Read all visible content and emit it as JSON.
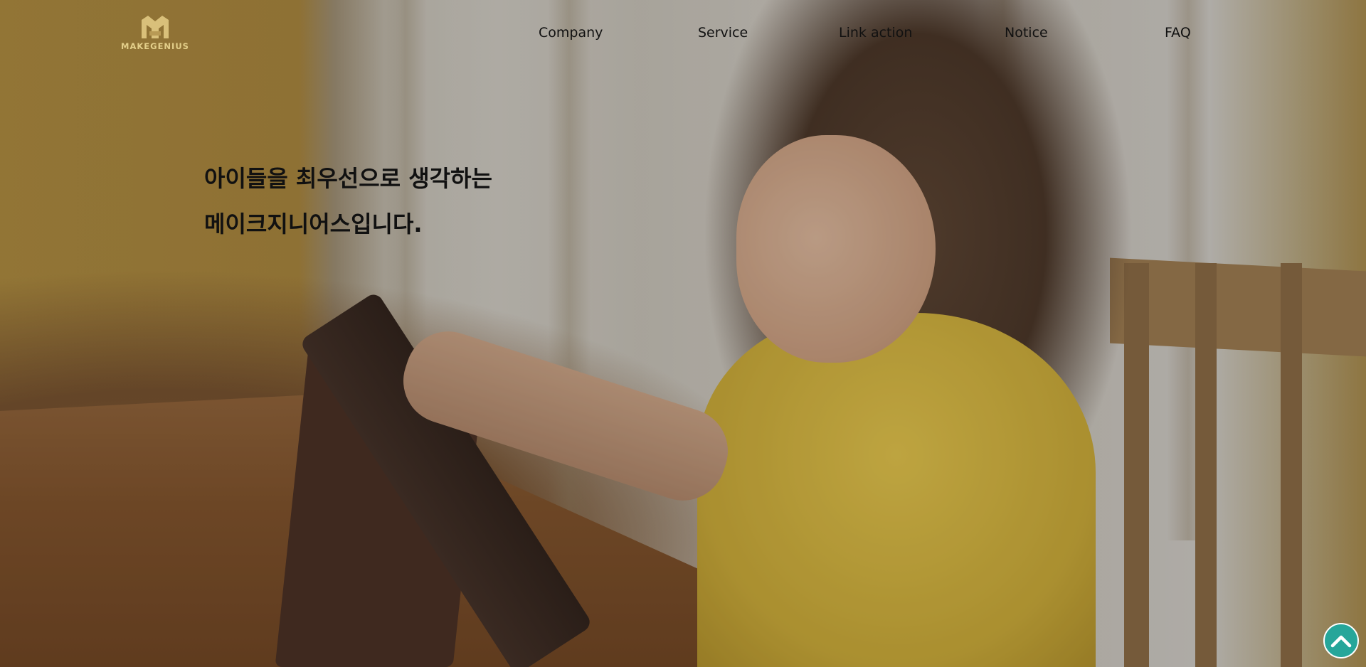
{
  "brand": {
    "logo_text": "MAKEGENIUS",
    "accent_color": "#d9c07a"
  },
  "nav": {
    "items": [
      {
        "label": "Company"
      },
      {
        "label": "Service"
      },
      {
        "label": "Link action"
      },
      {
        "label": "Notice"
      },
      {
        "label": "FAQ"
      }
    ]
  },
  "hero": {
    "headline_line1": "아이들을 최우선으로 생각하는",
    "headline_line2": "메이크지니어스입니다.",
    "image_description_icon": "hero-photo"
  },
  "scroll_top": {
    "icon": "chevron-up-icon",
    "color": "#26a69a"
  }
}
